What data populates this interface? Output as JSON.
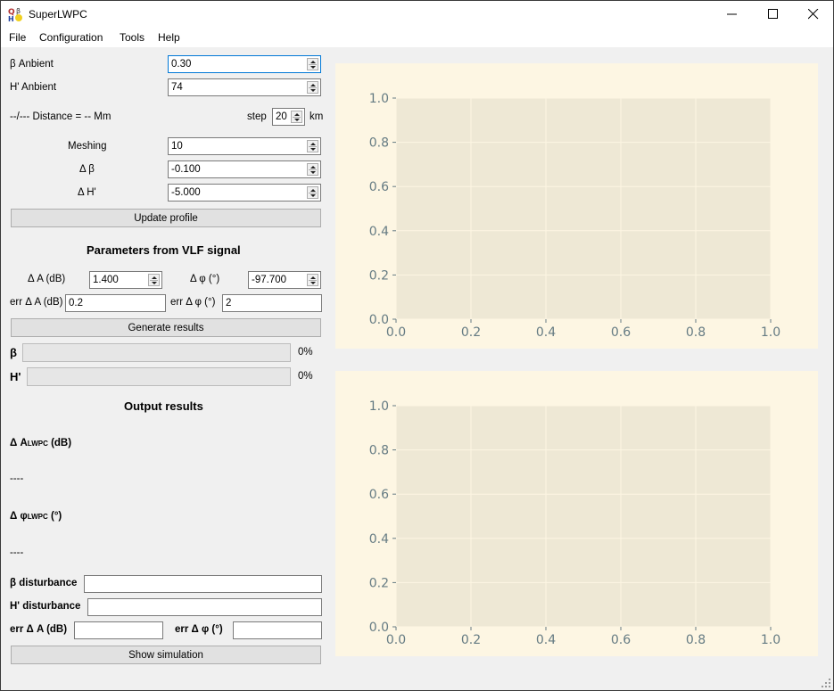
{
  "window": {
    "title": "SuperLWPC",
    "app_icon": "app-icon",
    "controls": [
      "minimize-icon",
      "maximize-icon",
      "close-icon"
    ]
  },
  "menubar": [
    "File",
    "Configuration",
    "Tools",
    "Help"
  ],
  "ambient": {
    "beta_label": "β Anbient",
    "beta_value": "0.30",
    "hprime_label": "H' Anbient",
    "hprime_value": "74",
    "distance_text": "--/--- Distance = -- Mm",
    "step_label": "step",
    "step_value": "20",
    "step_unit": "km"
  },
  "mesh": {
    "meshing_label": "Meshing",
    "meshing_value": "10",
    "dbeta_label": "Δ β",
    "dbeta_value": "-0.100",
    "dh_label": "Δ H'",
    "dh_value": "-5.000",
    "update_button": "Update profile"
  },
  "vlf": {
    "heading": "Parameters from VLF signal",
    "da_label": "Δ A (dB)",
    "da_value": "1.400",
    "dphi_label": "Δ φ (°)",
    "dphi_value": "-97.700",
    "err_da_label": "err Δ A (dB)",
    "err_da_value": "0.2",
    "err_dphi_label": "err Δ φ (°)",
    "err_dphi_value": "2",
    "generate_button": "Generate results"
  },
  "progress": {
    "beta_label": "β",
    "beta_percent": 0,
    "beta_text": "0%",
    "hprime_label": "H'",
    "hprime_percent": 0,
    "hprime_text": "0%"
  },
  "output": {
    "heading": "Output results",
    "da_lwpc_label_main": "Δ A",
    "da_lwpc_label_sub": "LWPC",
    "da_lwpc_label_unit": " (dB)",
    "da_lwpc_value": "----",
    "dphi_lwpc_label_main": "Δ φ",
    "dphi_lwpc_label_sub": "LWPC",
    "dphi_lwpc_label_unit": " (°)",
    "dphi_lwpc_value": "----",
    "beta_dist_label": "β disturbance",
    "beta_dist_value": "",
    "hprime_dist_label": "H' disturbance",
    "hprime_dist_value": "",
    "err_da_label": "err Δ A (dB)",
    "err_da_value": "",
    "err_dphi_label": "err Δ φ (°)",
    "err_dphi_value": "",
    "show_button": "Show simulation"
  },
  "colors": {
    "figure_bg": "#fdf6e3",
    "axes_bg": "#eee8d5",
    "grid": "#fdf6e3",
    "tick_text": "#657b83"
  },
  "chart_data": [
    {
      "type": "line",
      "title": "",
      "xlabel": "",
      "ylabel": "",
      "series": [],
      "xlim": [
        0.0,
        1.0
      ],
      "ylim": [
        0.0,
        1.0
      ],
      "xticks": [
        "0.0",
        "0.2",
        "0.4",
        "0.6",
        "0.8",
        "1.0"
      ],
      "yticks": [
        "0.0",
        "0.2",
        "0.4",
        "0.6",
        "0.8",
        "1.0"
      ],
      "grid": true,
      "legend": "none"
    },
    {
      "type": "line",
      "title": "",
      "xlabel": "",
      "ylabel": "",
      "series": [],
      "xlim": [
        0.0,
        1.0
      ],
      "ylim": [
        0.0,
        1.0
      ],
      "xticks": [
        "0.0",
        "0.2",
        "0.4",
        "0.6",
        "0.8",
        "1.0"
      ],
      "yticks": [
        "0.0",
        "0.2",
        "0.4",
        "0.6",
        "0.8",
        "1.0"
      ],
      "grid": true,
      "legend": "none"
    }
  ]
}
